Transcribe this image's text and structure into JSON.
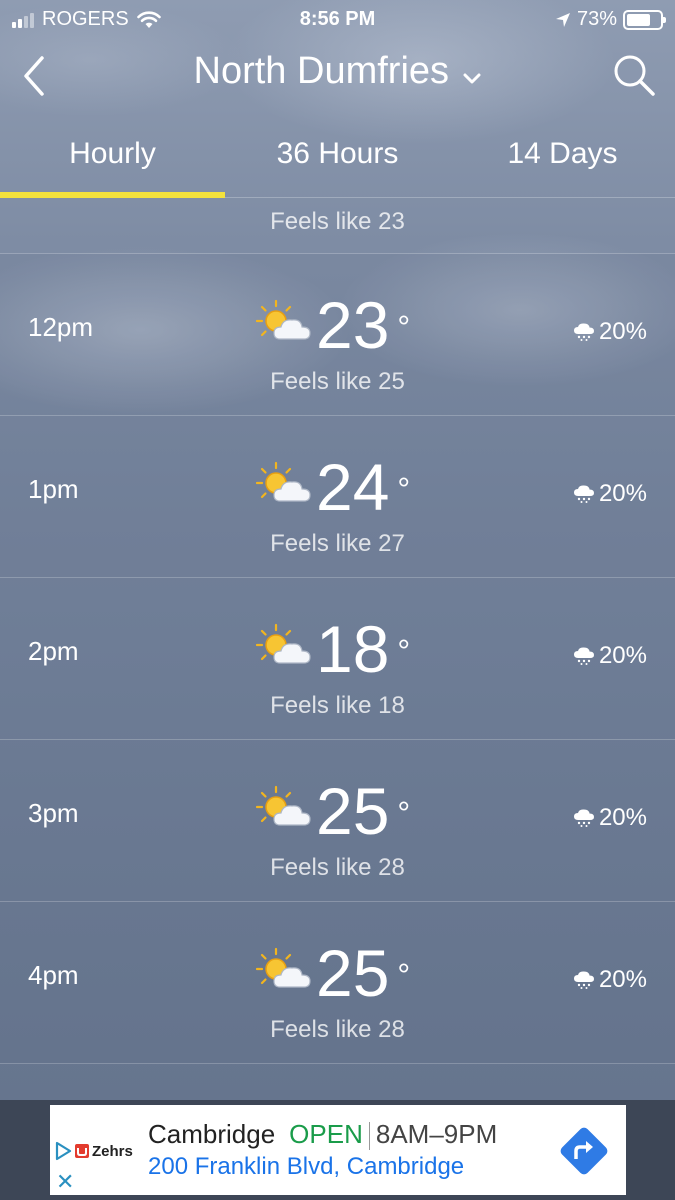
{
  "status_bar": {
    "carrier": "ROGERS",
    "time": "8:56 PM",
    "battery": "73%"
  },
  "header": {
    "location": "North Dumfries"
  },
  "tabs": [
    {
      "label": "Hourly",
      "active": true
    },
    {
      "label": "36 Hours",
      "active": false
    },
    {
      "label": "14 Days",
      "active": false
    }
  ],
  "partial_row": {
    "feels_like": "Feels like 23"
  },
  "hours": [
    {
      "time": "12pm",
      "temp": "23",
      "feels_like": "Feels like 25",
      "precip": "20%",
      "icon": "partly-sunny-icon"
    },
    {
      "time": "1pm",
      "temp": "24",
      "feels_like": "Feels like 27",
      "precip": "20%",
      "icon": "partly-sunny-icon"
    },
    {
      "time": "2pm",
      "temp": "18",
      "feels_like": "Feels like 18",
      "precip": "20%",
      "icon": "partly-sunny-icon"
    },
    {
      "time": "3pm",
      "temp": "25",
      "feels_like": "Feels like 28",
      "precip": "20%",
      "icon": "partly-sunny-icon"
    },
    {
      "time": "4pm",
      "temp": "25",
      "feels_like": "Feels like 28",
      "precip": "20%",
      "icon": "partly-sunny-icon"
    }
  ],
  "degree_symbol": "°",
  "ad": {
    "brand": "Zehrs",
    "name": "Cambridge",
    "status": "OPEN",
    "hours": "8AM–9PM",
    "address": "200 Franklin Blvd, Cambridge",
    "close_symbol": "✕"
  },
  "colors": {
    "tab_indicator": "#f4e23c",
    "ad_open": "#1a9c4a",
    "ad_address": "#1a73e8",
    "directions_button": "#2f7be5"
  }
}
